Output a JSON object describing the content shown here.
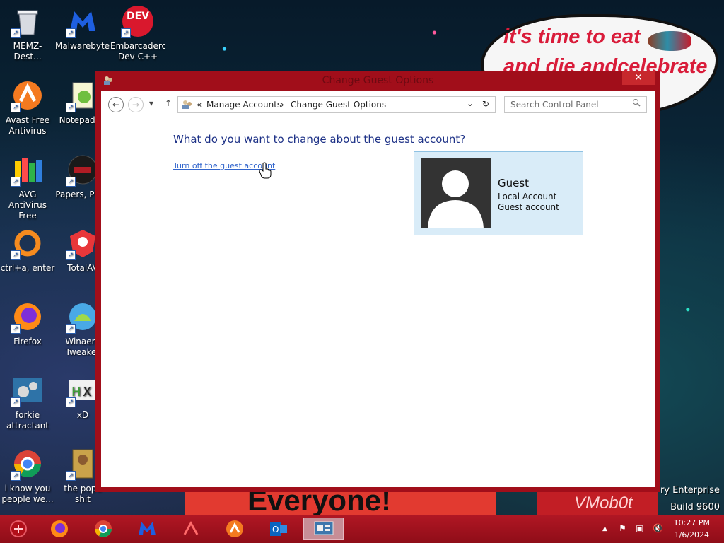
{
  "desktop": {
    "speech_bubble": {
      "line1": "it's time to eat",
      "line2": "and die andcelebrate"
    },
    "poster_text": "Everyone!",
    "watermark_text": "VMob0t",
    "version": {
      "line1": "ry Enterprise",
      "line2": "Build 9600"
    },
    "icons": [
      {
        "label": "MEMZ-Dest...",
        "icon": "recycle-bin-icon"
      },
      {
        "label": "Malwarebytes",
        "icon": "malwarebytes-icon"
      },
      {
        "label": "Embarcadero Dev-C++",
        "icon": "devcpp-icon",
        "badge": "DEV"
      },
      {
        "label": "Avast Free Antivirus",
        "icon": "avast-icon"
      },
      {
        "label": "Notepad-...",
        "icon": "notepad-icon"
      },
      {
        "label": "AVG AntiVirus Free",
        "icon": "avg-icon"
      },
      {
        "label": "Papers, Ple...",
        "icon": "papers-please-icon"
      },
      {
        "label": "ctrl+a, enter",
        "icon": "ring-icon"
      },
      {
        "label": "TotalAV",
        "icon": "totalav-icon"
      },
      {
        "label": "Firefox",
        "icon": "firefox-icon"
      },
      {
        "label": "Winaero Tweaker",
        "icon": "winaero-icon"
      },
      {
        "label": "forkie attractant",
        "icon": "gears-icon"
      },
      {
        "label": "xD",
        "icon": "hex-icon"
      },
      {
        "label": "i know you people we...",
        "icon": "chrome-icon"
      },
      {
        "label": "the pope shit",
        "icon": "pope-image-icon"
      }
    ]
  },
  "window": {
    "title": "Change Guest Options",
    "close_label": "✕",
    "nav": {
      "back": "←",
      "forward": "→",
      "dropdown": "▾",
      "up": "↑"
    },
    "address": {
      "prefix": "«",
      "crumb1": "Manage Accounts",
      "separator": "›",
      "crumb2": "Change Guest Options",
      "dropdown": "⌄",
      "refresh": "↻"
    },
    "search_placeholder": "Search Control Panel",
    "heading": "What do you want to change about the guest account?",
    "link_label": "Turn off the guest account",
    "guest": {
      "name": "Guest",
      "type": "Local Account",
      "detail": "Guest account"
    }
  },
  "taskbar": {
    "items": [
      "start-icon",
      "firefox-icon",
      "chrome-icon",
      "malwarebytes-icon",
      "avast-icon",
      "avast-orange-icon",
      "outlook-icon",
      "control-panel-icon"
    ],
    "tray": {
      "arrow": "▲",
      "flag": "⚑",
      "network": "▣",
      "volume": "🔇"
    },
    "time": "10:27 PM",
    "date": "1/6/2024"
  },
  "colors": {
    "window_frame": "#a10e1a",
    "link": "#3366cc",
    "heading": "#1e3287",
    "guest_card_bg": "#d9ecf8",
    "taskbar": "#b11724"
  }
}
